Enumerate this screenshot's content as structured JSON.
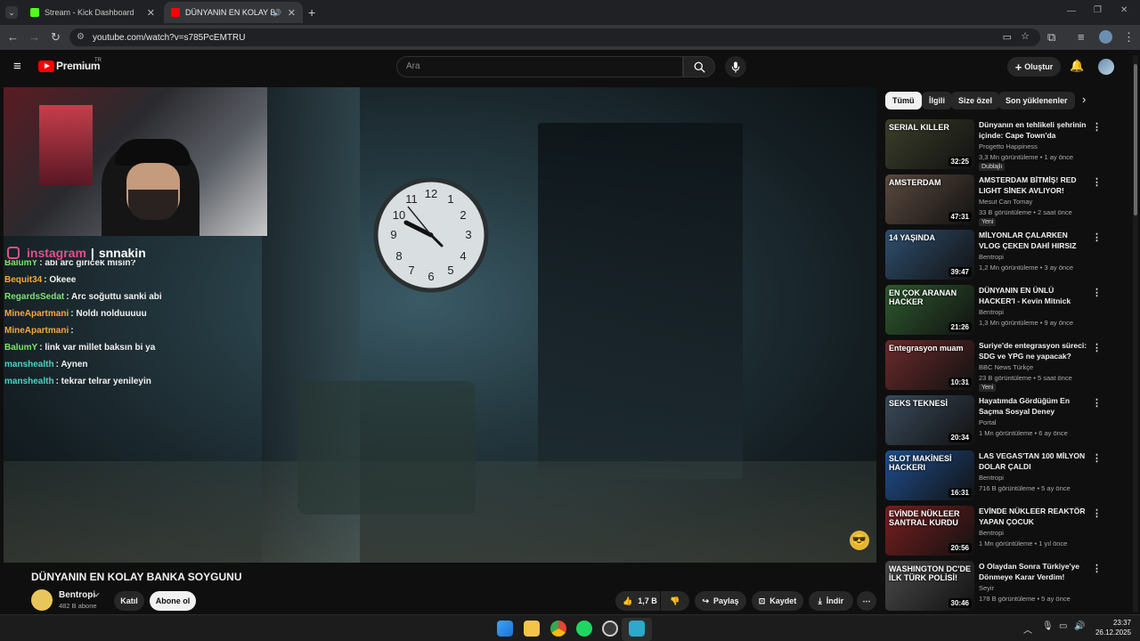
{
  "browser": {
    "tabs": [
      {
        "title": "Stream - Kick Dashboard",
        "color": "#53fc18"
      },
      {
        "title": "DÜNYANIN EN KOLAY BANK",
        "color": "#ff0000"
      }
    ],
    "url": "youtube.com/watch?v=s785PcEMTRU"
  },
  "header": {
    "logo": "Premium",
    "region": "TR",
    "search_placeholder": "Ara",
    "create_label": "Oluştur"
  },
  "overlay": {
    "instagram_prefix": "instagram",
    "instagram_user": "snnakin"
  },
  "chat": [
    {
      "user": "BalumY",
      "user_color": "#7ee26f",
      "msg": ": abi arc giricek misin?"
    },
    {
      "user": "Bequit34",
      "user_color": "#f4a93b",
      "msg": ": Okeee"
    },
    {
      "user": "RegardsSedat",
      "user_color": "#7ee26f",
      "msg": ": Arc soğuttu sanki abi"
    },
    {
      "user": "MineApartmani",
      "user_color": "#f4a93b",
      "msg": ": Noldı nolduuuuu"
    },
    {
      "user": "MineApartmani",
      "user_color": "#f4a93b",
      "msg": ":"
    },
    {
      "user": "BalumY",
      "user_color": "#7ee26f",
      "msg": ": link var millet baksın bi ya"
    },
    {
      "user": "manshealth",
      "user_color": "#4fd1c5",
      "msg": ": Aynen"
    },
    {
      "user": "manshealth",
      "user_color": "#4fd1c5",
      "msg": ": tekrar telrar yenileyin"
    }
  ],
  "video": {
    "title": "DÜNYANIN EN KOLAY BANKA SOYGUNU",
    "channel": "Bentropi",
    "subscribers": "482 B abone",
    "join_label": "Katıl",
    "subscribe_label": "Abone ol",
    "likes": "1,7 B",
    "share_label": "Paylaş",
    "save_label": "Kaydet",
    "download_label": "İndir"
  },
  "chips": [
    "Tümü",
    "İlgili",
    "Size özel",
    "Son yüklenenler"
  ],
  "recommendations": [
    {
      "thumb_text": "SERIAL KILLER",
      "title": "Dünyanın en tehlikeli şehrinin içinde: Cape Town'da yaşamak...",
      "channel": "Progetto Happiness",
      "meta": "3,3 Mn görüntüleme • 1 ay önce",
      "badge": "Dublajlı",
      "duration": "32:25",
      "thumb_color": "#3b3f2a"
    },
    {
      "thumb_text": "AMSTERDAM",
      "title": "AMSTERDAM BİTMİŞ! RED LIGHT SİNEK AVLIYOR!",
      "channel": "Mesut Can Tomay",
      "meta": "33 B görüntüleme • 2 saat önce",
      "badge": "Yeni",
      "duration": "47:31",
      "thumb_color": "#5b4a3f"
    },
    {
      "thumb_text": "14 YAŞINDA",
      "title": "MİLYONLAR ÇALARKEN VLOG ÇEKEN DAHİ HIRSIZ",
      "channel": "Bentropi",
      "meta": "1,2 Mn görüntüleme • 3 ay önce",
      "badge": "",
      "duration": "39:47",
      "thumb_color": "#2f4f6f"
    },
    {
      "thumb_text": "EN ÇOK ARANAN HACKER",
      "title": "DÜNYANIN EN ÜNLÜ HACKER'I - Kevin Mitnick",
      "channel": "Bentropi",
      "meta": "1,3 Mn görüntüleme • 9 ay önce",
      "badge": "",
      "duration": "21:26",
      "thumb_color": "#2e5b2e"
    },
    {
      "thumb_text": "Entegrasyon muam",
      "title": "Suriye'de entegrasyon süreci: SDG ve YPG ne yapacak?",
      "channel": "BBC News Türkçe",
      "meta": "23 B görüntüleme • 5 saat önce",
      "badge": "Yeni",
      "duration": "10:31",
      "thumb_color": "#6b2a2a"
    },
    {
      "thumb_text": "SEKS TEKNESİ",
      "title": "Hayatımda Gördüğüm En Saçma Sosyal Deney",
      "channel": "Portal",
      "meta": "1 Mn görüntüleme • 6 ay önce",
      "badge": "",
      "duration": "20:34",
      "thumb_color": "#3a4b5c"
    },
    {
      "thumb_text": "SLOT MAKİNESİ HACKERI",
      "title": "LAS VEGAS'TAN 100 MİLYON DOLAR ÇALDI",
      "channel": "Bentropi",
      "meta": "716 B görüntüleme • 5 ay önce",
      "badge": "",
      "duration": "16:31",
      "thumb_color": "#1f4f8f"
    },
    {
      "thumb_text": "EVİNDE NÜKLEER SANTRAL KURDU",
      "title": "EVİNDE NÜKLEER REAKTÖR YAPAN ÇOCUK",
      "channel": "Bentropi",
      "meta": "1 Mn görüntüleme • 1 yıl önce",
      "badge": "",
      "duration": "20:56",
      "thumb_color": "#7a1f1f"
    },
    {
      "thumb_text": "WASHINGTON DC'DE İLK TÜRK POLİSİ!",
      "title": "O Olaydan Sonra Türkiye'ye Dönmeye Karar Verdim!",
      "channel": "Seyir",
      "meta": "178 B görüntüleme • 5 ay önce",
      "badge": "",
      "duration": "30:46",
      "thumb_color": "#4a4a4a"
    }
  ],
  "taskbar": {
    "time": "23:37",
    "date": "26.12.2025"
  }
}
